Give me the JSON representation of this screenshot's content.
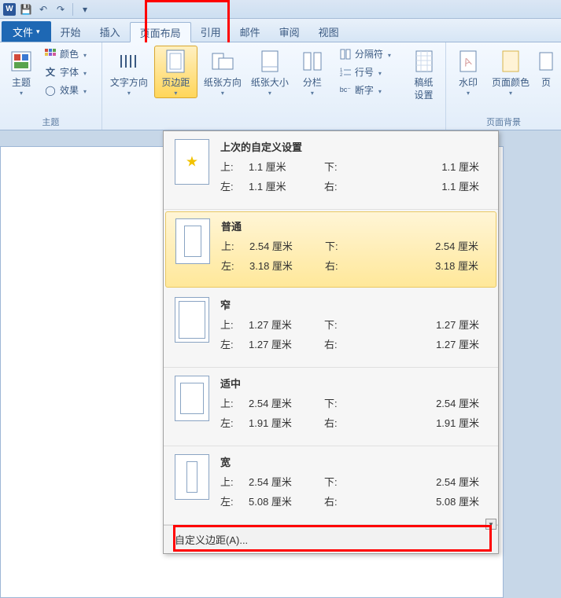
{
  "qat": {
    "save_title": "保存",
    "undo_title": "撤销",
    "redo_title": "重做"
  },
  "tabs": {
    "file": "文件",
    "home": "开始",
    "insert": "插入",
    "layout": "页面布局",
    "references": "引用",
    "mailings": "邮件",
    "review": "审阅",
    "view": "视图"
  },
  "ribbon": {
    "theme_group": "主题",
    "theme": "主题",
    "colors": "颜色",
    "fonts": "字体",
    "effects": "效果",
    "text_direction": "文字方向",
    "margins": "页边距",
    "orientation": "纸张方向",
    "size": "纸张大小",
    "columns": "分栏",
    "breaks": "分隔符",
    "line_numbers": "行号",
    "hyphenation": "断字",
    "manuscript": "稿纸\n设置",
    "watermark": "水印",
    "page_color": "页面颜色",
    "page_prefix": "页",
    "page_bg_group": "页面背景"
  },
  "margins_menu": {
    "options": [
      {
        "title": "上次的自定义设置",
        "top_lbl": "上:",
        "top": "1.1 厘米",
        "bottom_lbl": "下:",
        "bottom": "1.1 厘米",
        "left_lbl": "左:",
        "left": "1.1 厘米",
        "right_lbl": "右:",
        "right": "1.1 厘米",
        "star": true
      },
      {
        "title": "普通",
        "top_lbl": "上:",
        "top": "2.54 厘米",
        "bottom_lbl": "下:",
        "bottom": "2.54 厘米",
        "left_lbl": "左:",
        "left": "3.18 厘米",
        "right_lbl": "右:",
        "right": "3.18 厘米"
      },
      {
        "title": "窄",
        "top_lbl": "上:",
        "top": "1.27 厘米",
        "bottom_lbl": "下:",
        "bottom": "1.27 厘米",
        "left_lbl": "左:",
        "left": "1.27 厘米",
        "right_lbl": "右:",
        "right": "1.27 厘米"
      },
      {
        "title": "适中",
        "top_lbl": "上:",
        "top": "2.54 厘米",
        "bottom_lbl": "下:",
        "bottom": "2.54 厘米",
        "left_lbl": "左:",
        "left": "1.91 厘米",
        "right_lbl": "右:",
        "right": "1.91 厘米"
      },
      {
        "title": "宽",
        "top_lbl": "上:",
        "top": "2.54 厘米",
        "bottom_lbl": "下:",
        "bottom": "2.54 厘米",
        "left_lbl": "左:",
        "left": "5.08 厘米",
        "right_lbl": "右:",
        "right": "5.08 厘米"
      }
    ],
    "custom": "自定义边距(A)..."
  }
}
